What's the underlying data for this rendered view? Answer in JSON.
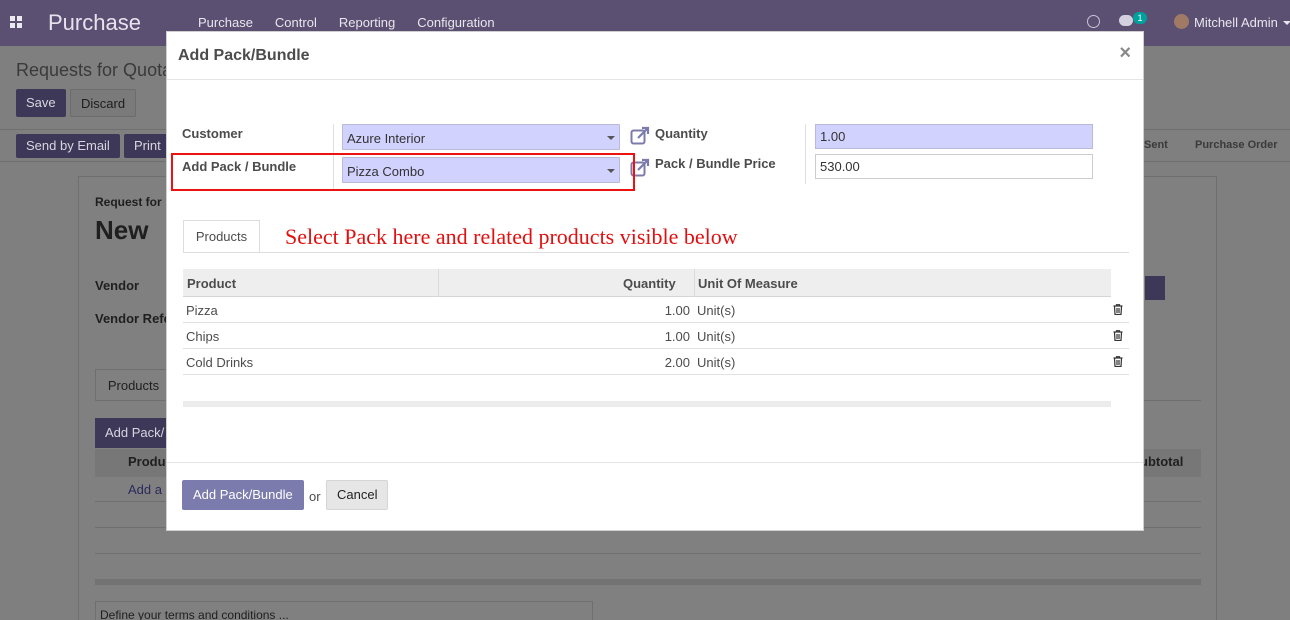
{
  "navbar": {
    "app_name": "Purchase",
    "menu": [
      "Purchase",
      "Control",
      "Reporting",
      "Configuration"
    ],
    "chat_count": "1",
    "user_name": "Mitchell Admin"
  },
  "control_panel": {
    "breadcrumb": "Requests for Quota",
    "save_label": "Save",
    "discard_label": "Discard"
  },
  "status_bar": {
    "send_email_label": "Send by Email",
    "print_label": "Print",
    "stage_sent": "Sent",
    "stage_purchase_order": "Purchase Order"
  },
  "sheet": {
    "request_for": "Request for",
    "record_name": "New",
    "vendor_label": "Vendor",
    "vendor_ref_label": "Vendor Refe",
    "products_tab": "Products",
    "add_pack_button": "Add Pack/",
    "product_col": "Produ",
    "add_line": "Add a",
    "subtotal_col": "ubtotal",
    "terms_placeholder": "Define your terms and conditions ..."
  },
  "modal": {
    "title": "Add Pack/Bundle",
    "close_symbol": "×",
    "customer_label": "Customer",
    "customer_value": "Azure Interior",
    "pack_label": "Add Pack / Bundle",
    "pack_value": "Pizza Combo",
    "quantity_label": "Quantity",
    "quantity_value": "1.00",
    "price_label": "Pack / Bundle Price",
    "price_value": "530.00",
    "tab_products": "Products",
    "annotation": "Select Pack here and related products visible below",
    "table": {
      "headers": [
        "Product",
        "Quantity",
        "Unit Of Measure"
      ],
      "rows": [
        {
          "product": "Pizza",
          "quantity": "1.00",
          "uom": "Unit(s)"
        },
        {
          "product": "Chips",
          "quantity": "1.00",
          "uom": "Unit(s)"
        },
        {
          "product": "Cold Drinks",
          "quantity": "2.00",
          "uom": "Unit(s)"
        }
      ]
    },
    "footer": {
      "add_button": "Add Pack/Bundle",
      "or_text": "or",
      "cancel_button": "Cancel"
    }
  },
  "colors": {
    "accent": "#7c7bad",
    "navbar": "#5b5072",
    "required_field": "#d2d2ff",
    "annotation": "#e01010"
  }
}
